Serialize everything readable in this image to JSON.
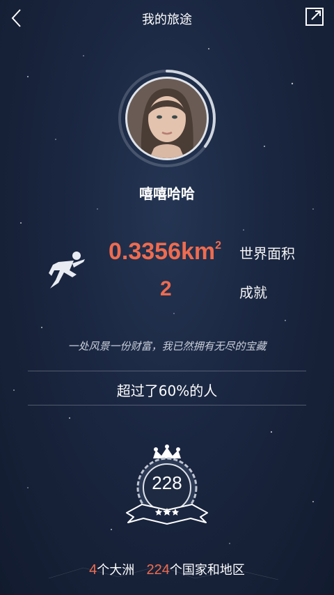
{
  "header": {
    "title": "我的旅途",
    "back_icon": "chevron-left-icon",
    "share_icon": "share-external-icon"
  },
  "profile": {
    "username": "嘻嘻哈哈",
    "progress": 0.35
  },
  "stats": {
    "area_value": "0.3356km",
    "area_superscript": "2",
    "area_label": "世界面积",
    "achievements_value": "2",
    "achievements_label": "成就"
  },
  "motto": "一处风景一份财富，我已然拥有无尽的宝藏",
  "beat_text": "超过了60%的人",
  "badge": {
    "value": "228"
  },
  "footer": {
    "continents_count": "4",
    "continents_label": "个大洲",
    "countries_count": "224",
    "countries_label": "个国家和地区"
  },
  "colors": {
    "accent": "#ef6b4f",
    "background": "#1a2640"
  }
}
